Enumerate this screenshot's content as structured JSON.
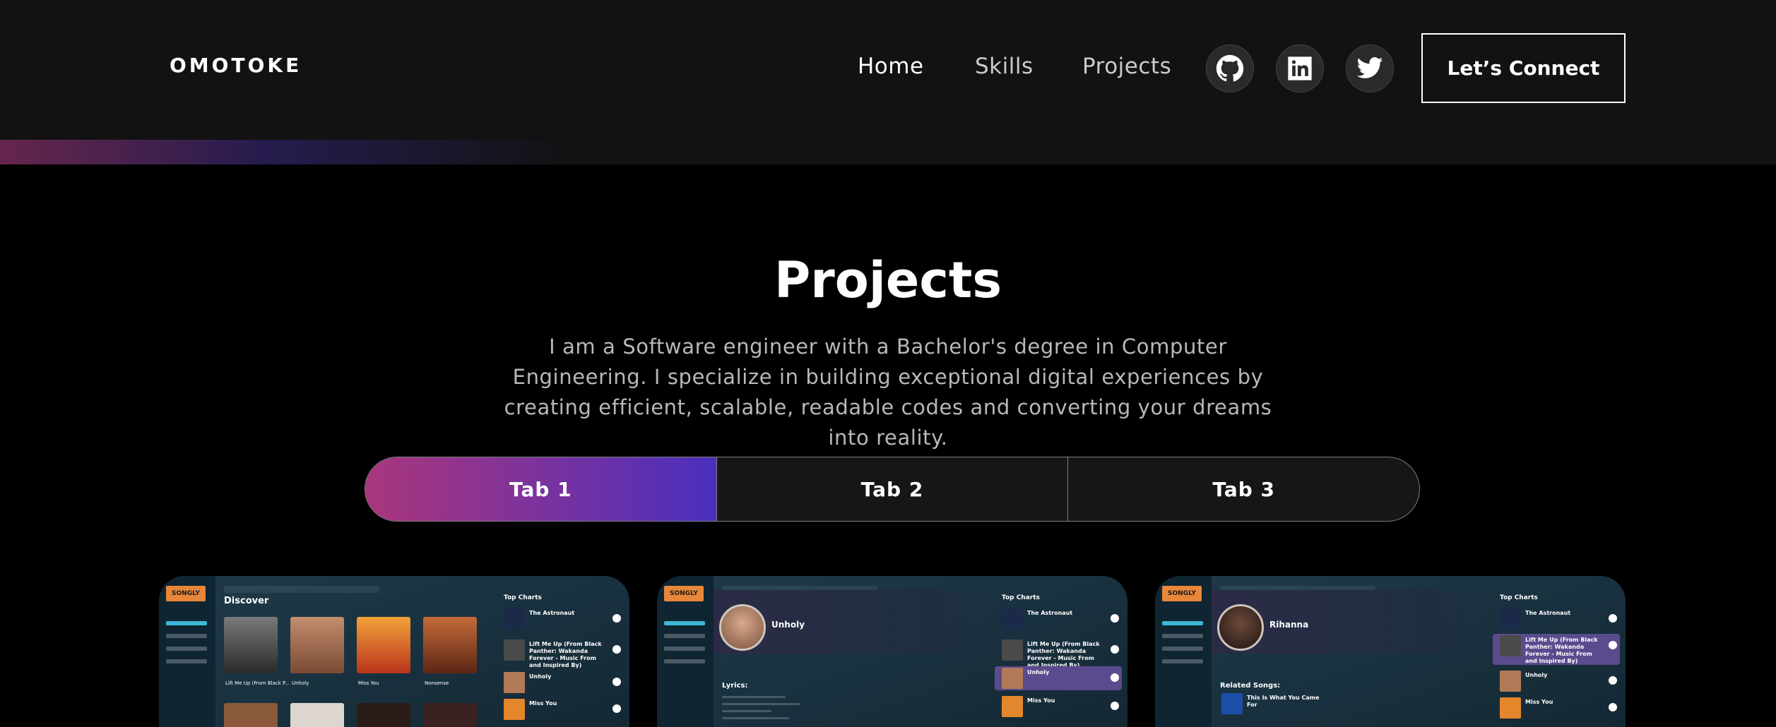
{
  "nav": {
    "logo": "OMOTOKE",
    "links": [
      "Home",
      "Skills",
      "Projects"
    ],
    "social": [
      "github-icon",
      "linkedin-icon",
      "twitter-icon"
    ],
    "connect_label": "Let’s Connect"
  },
  "projects": {
    "title": "Projects",
    "description": "I am a Software engineer with a Bachelor's degree in Computer Engineering. I specialize in building exceptional digital experiences by creating efficient, scalable, readable codes and converting your dreams into reality.",
    "tabs": [
      "Tab 1",
      "Tab 2",
      "Tab 3"
    ],
    "active_tab": "Tab 1"
  },
  "cards": [
    {
      "brand": "SONGLY",
      "heading": "Discover",
      "albums": [
        "Lift Me Up (From Black P...",
        "Unholy",
        "Miss You",
        "Nonsense"
      ],
      "charts_title": "Top Charts",
      "charts": [
        "The Astronaut",
        "Lift Me Up (From Black Panther: Wakanda Forever - Music From and Inspired By)",
        "Unholy",
        "Miss You"
      ]
    },
    {
      "brand": "SONGLY",
      "artist": "Unholy",
      "sub_heading": "Lyrics:",
      "charts_title": "Top Charts",
      "charts": [
        "The Astronaut",
        "Lift Me Up (From Black Panther: Wakanda Forever - Music From and Inspired By)",
        "Unholy",
        "Miss You"
      ]
    },
    {
      "brand": "SONGLY",
      "artist": "Rihanna",
      "sub_heading": "Related Songs:",
      "related": [
        "This Is What You Came For"
      ],
      "charts_title": "Top Charts",
      "charts": [
        "The Astronaut",
        "Lift Me Up (From Black Panther: Wakanda Forever - Music From and Inspired By)",
        "Unholy",
        "Miss You"
      ]
    }
  ],
  "colors": {
    "accent_start": "#aa367c",
    "accent_end": "#4a2fbd",
    "nav_bg": "#121212"
  }
}
